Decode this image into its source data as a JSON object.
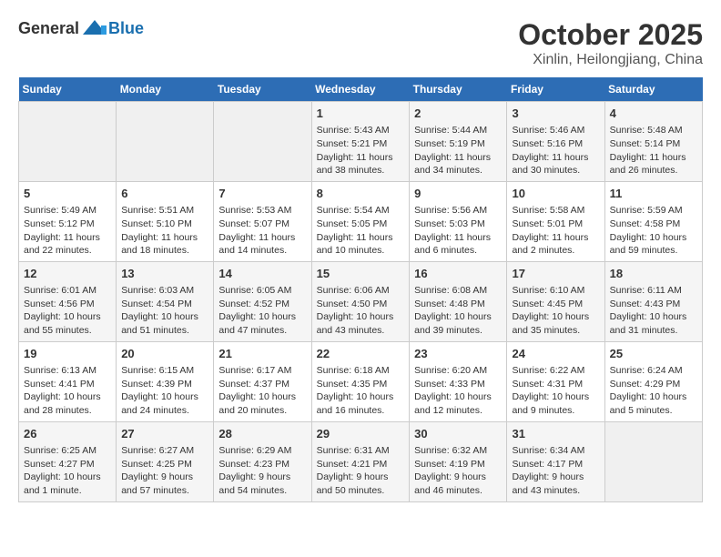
{
  "header": {
    "logo_general": "General",
    "logo_blue": "Blue",
    "month": "October 2025",
    "location": "Xinlin, Heilongjiang, China"
  },
  "weekdays": [
    "Sunday",
    "Monday",
    "Tuesday",
    "Wednesday",
    "Thursday",
    "Friday",
    "Saturday"
  ],
  "weeks": [
    [
      {
        "day": "",
        "info": ""
      },
      {
        "day": "",
        "info": ""
      },
      {
        "day": "",
        "info": ""
      },
      {
        "day": "1",
        "info": "Sunrise: 5:43 AM\nSunset: 5:21 PM\nDaylight: 11 hours and 38 minutes."
      },
      {
        "day": "2",
        "info": "Sunrise: 5:44 AM\nSunset: 5:19 PM\nDaylight: 11 hours and 34 minutes."
      },
      {
        "day": "3",
        "info": "Sunrise: 5:46 AM\nSunset: 5:16 PM\nDaylight: 11 hours and 30 minutes."
      },
      {
        "day": "4",
        "info": "Sunrise: 5:48 AM\nSunset: 5:14 PM\nDaylight: 11 hours and 26 minutes."
      }
    ],
    [
      {
        "day": "5",
        "info": "Sunrise: 5:49 AM\nSunset: 5:12 PM\nDaylight: 11 hours and 22 minutes."
      },
      {
        "day": "6",
        "info": "Sunrise: 5:51 AM\nSunset: 5:10 PM\nDaylight: 11 hours and 18 minutes."
      },
      {
        "day": "7",
        "info": "Sunrise: 5:53 AM\nSunset: 5:07 PM\nDaylight: 11 hours and 14 minutes."
      },
      {
        "day": "8",
        "info": "Sunrise: 5:54 AM\nSunset: 5:05 PM\nDaylight: 11 hours and 10 minutes."
      },
      {
        "day": "9",
        "info": "Sunrise: 5:56 AM\nSunset: 5:03 PM\nDaylight: 11 hours and 6 minutes."
      },
      {
        "day": "10",
        "info": "Sunrise: 5:58 AM\nSunset: 5:01 PM\nDaylight: 11 hours and 2 minutes."
      },
      {
        "day": "11",
        "info": "Sunrise: 5:59 AM\nSunset: 4:58 PM\nDaylight: 10 hours and 59 minutes."
      }
    ],
    [
      {
        "day": "12",
        "info": "Sunrise: 6:01 AM\nSunset: 4:56 PM\nDaylight: 10 hours and 55 minutes."
      },
      {
        "day": "13",
        "info": "Sunrise: 6:03 AM\nSunset: 4:54 PM\nDaylight: 10 hours and 51 minutes."
      },
      {
        "day": "14",
        "info": "Sunrise: 6:05 AM\nSunset: 4:52 PM\nDaylight: 10 hours and 47 minutes."
      },
      {
        "day": "15",
        "info": "Sunrise: 6:06 AM\nSunset: 4:50 PM\nDaylight: 10 hours and 43 minutes."
      },
      {
        "day": "16",
        "info": "Sunrise: 6:08 AM\nSunset: 4:48 PM\nDaylight: 10 hours and 39 minutes."
      },
      {
        "day": "17",
        "info": "Sunrise: 6:10 AM\nSunset: 4:45 PM\nDaylight: 10 hours and 35 minutes."
      },
      {
        "day": "18",
        "info": "Sunrise: 6:11 AM\nSunset: 4:43 PM\nDaylight: 10 hours and 31 minutes."
      }
    ],
    [
      {
        "day": "19",
        "info": "Sunrise: 6:13 AM\nSunset: 4:41 PM\nDaylight: 10 hours and 28 minutes."
      },
      {
        "day": "20",
        "info": "Sunrise: 6:15 AM\nSunset: 4:39 PM\nDaylight: 10 hours and 24 minutes."
      },
      {
        "day": "21",
        "info": "Sunrise: 6:17 AM\nSunset: 4:37 PM\nDaylight: 10 hours and 20 minutes."
      },
      {
        "day": "22",
        "info": "Sunrise: 6:18 AM\nSunset: 4:35 PM\nDaylight: 10 hours and 16 minutes."
      },
      {
        "day": "23",
        "info": "Sunrise: 6:20 AM\nSunset: 4:33 PM\nDaylight: 10 hours and 12 minutes."
      },
      {
        "day": "24",
        "info": "Sunrise: 6:22 AM\nSunset: 4:31 PM\nDaylight: 10 hours and 9 minutes."
      },
      {
        "day": "25",
        "info": "Sunrise: 6:24 AM\nSunset: 4:29 PM\nDaylight: 10 hours and 5 minutes."
      }
    ],
    [
      {
        "day": "26",
        "info": "Sunrise: 6:25 AM\nSunset: 4:27 PM\nDaylight: 10 hours and 1 minute."
      },
      {
        "day": "27",
        "info": "Sunrise: 6:27 AM\nSunset: 4:25 PM\nDaylight: 9 hours and 57 minutes."
      },
      {
        "day": "28",
        "info": "Sunrise: 6:29 AM\nSunset: 4:23 PM\nDaylight: 9 hours and 54 minutes."
      },
      {
        "day": "29",
        "info": "Sunrise: 6:31 AM\nSunset: 4:21 PM\nDaylight: 9 hours and 50 minutes."
      },
      {
        "day": "30",
        "info": "Sunrise: 6:32 AM\nSunset: 4:19 PM\nDaylight: 9 hours and 46 minutes."
      },
      {
        "day": "31",
        "info": "Sunrise: 6:34 AM\nSunset: 4:17 PM\nDaylight: 9 hours and 43 minutes."
      },
      {
        "day": "",
        "info": ""
      }
    ]
  ]
}
